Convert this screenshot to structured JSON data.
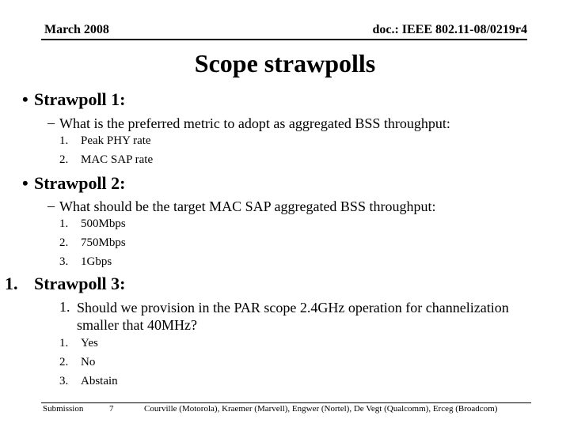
{
  "header": {
    "date": "March 2008",
    "doc_id": "doc.: IEEE 802.11-08/0219r4"
  },
  "title": "Scope strawpolls",
  "strawpolls": [
    {
      "marker": "•",
      "label": "Strawpoll 1:",
      "question_marker": "–",
      "question": "What is the preferred metric to adopt as aggregated BSS throughput:",
      "options": [
        {
          "marker": "1.",
          "text": "Peak PHY rate"
        },
        {
          "marker": "2.",
          "text": "MAC SAP rate"
        }
      ]
    },
    {
      "marker": "•",
      "label": "Strawpoll 2:",
      "question_marker": "–",
      "question": "What should be the target MAC SAP aggregated BSS throughput:",
      "options": [
        {
          "marker": "1.",
          "text": "500Mbps"
        },
        {
          "marker": "2.",
          "text": "750Mbps"
        },
        {
          "marker": "3.",
          "text": "1Gbps"
        }
      ]
    },
    {
      "marker": "1.",
      "label": "Strawpoll 3:",
      "question_marker": "1.",
      "question_line1": "Should we provision in the PAR scope 2.4GHz operation for channelization",
      "question_line2": "smaller that 40MHz?",
      "options": [
        {
          "marker": "1.",
          "text": "Yes"
        },
        {
          "marker": "2.",
          "text": "No"
        },
        {
          "marker": "3.",
          "text": "Abstain"
        }
      ]
    }
  ],
  "footer": {
    "label": "Submission",
    "page_number": "7",
    "authors": "Courville (Motorola), Kraemer (Marvell), Engwer (Nortel), De Vegt (Qualcomm), Erceg (Broadcom)"
  }
}
